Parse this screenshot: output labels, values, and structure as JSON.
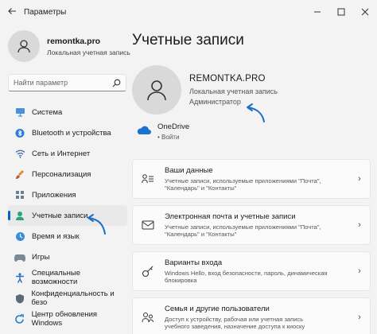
{
  "window": {
    "title": "Параметры",
    "back_icon": "arrow-left-icon",
    "controls": [
      "minimize-icon",
      "maximize-icon",
      "close-icon"
    ]
  },
  "sidebar": {
    "profile": {
      "name": "remontka.pro",
      "type": "Локальная учетная запись"
    },
    "search": {
      "placeholder": "Найти параметр"
    },
    "items": [
      {
        "label": "Система",
        "icon": "monitor-icon"
      },
      {
        "label": "Bluetooth и устройства",
        "icon": "bluetooth-icon"
      },
      {
        "label": "Сеть и Интернет",
        "icon": "wifi-icon"
      },
      {
        "label": "Персонализация",
        "icon": "brush-icon"
      },
      {
        "label": "Приложения",
        "icon": "apps-icon"
      },
      {
        "label": "Учетные записи",
        "icon": "person-icon",
        "active": true
      },
      {
        "label": "Время и язык",
        "icon": "globe-clock-icon"
      },
      {
        "label": "Игры",
        "icon": "gamepad-icon"
      },
      {
        "label": "Специальные возможности",
        "icon": "accessibility-icon"
      },
      {
        "label": "Конфиденциальность и безо",
        "icon": "shield-icon"
      },
      {
        "label": "Центр обновления Windows",
        "icon": "update-icon"
      }
    ]
  },
  "main": {
    "title": "Учетные записи",
    "account": {
      "name": "REMONTKA.PRO",
      "type": "Локальная учетная запись",
      "role": "Администратор"
    },
    "onedrive": {
      "name": "OneDrive",
      "action": "Войти"
    },
    "cards": [
      {
        "title": "Ваши данные",
        "desc1": "Учетные записи, используемые приложениями \"Почта\",",
        "desc2": "\"Календарь\" и \"Контакты\"",
        "icon": "user-info-icon"
      },
      {
        "title": "Электронная почта и учетные записи",
        "desc1": "Учетные записи, используемые приложениями \"Почта\",",
        "desc2": "\"Календарь\" и \"Контакты\"",
        "icon": "mail-icon"
      },
      {
        "title": "Варианты входа",
        "desc1": "Windows Hello, вход безопасности, пароль, динамическая",
        "desc2": "блокировка",
        "icon": "key-icon"
      },
      {
        "title": "Семья и другие пользователи",
        "desc1": "Доступ к устройству, рабочая или учетная запись",
        "desc2": "учебного заведения, назначение доступа к киоску",
        "icon": "family-icon"
      }
    ]
  },
  "colors": {
    "accent": "#0067c0",
    "background": "#f3f3f3",
    "annotation_arrow": "#1a6fc4"
  }
}
